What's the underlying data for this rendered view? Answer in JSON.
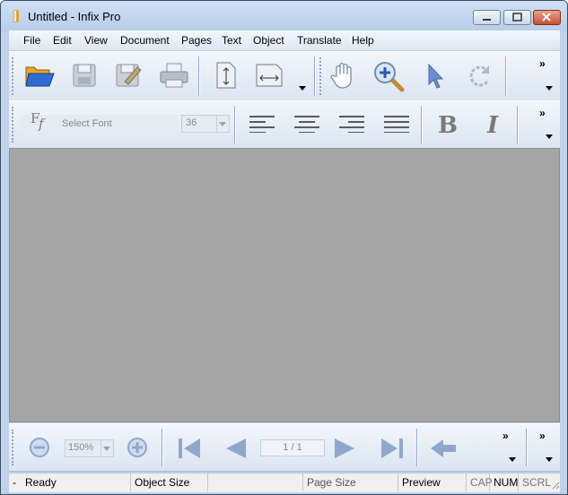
{
  "window": {
    "title": "Untitled - Infix Pro"
  },
  "menu": [
    "File",
    "Edit",
    "View",
    "Document",
    "Pages",
    "Text",
    "Object",
    "Translate",
    "Help"
  ],
  "toolbar1": {
    "chevron": "»"
  },
  "toolbar2": {
    "font_placeholder": "Select Font",
    "font_size": "36",
    "chevron": "»"
  },
  "toolbar3": {
    "zoom": "150%",
    "page": "1 / 1",
    "chevron": "»"
  },
  "status": {
    "ready": "Ready",
    "object_size": "Object Size",
    "page_size": "Page Size",
    "preview": "Preview",
    "cap": "CAP",
    "num": "NUM",
    "scrl": "SCRL",
    "dash": "-"
  },
  "colors": {
    "accent": "#6d8fcf",
    "canvas": "#a5a5a5",
    "toolbar": "#dbe5f1"
  }
}
